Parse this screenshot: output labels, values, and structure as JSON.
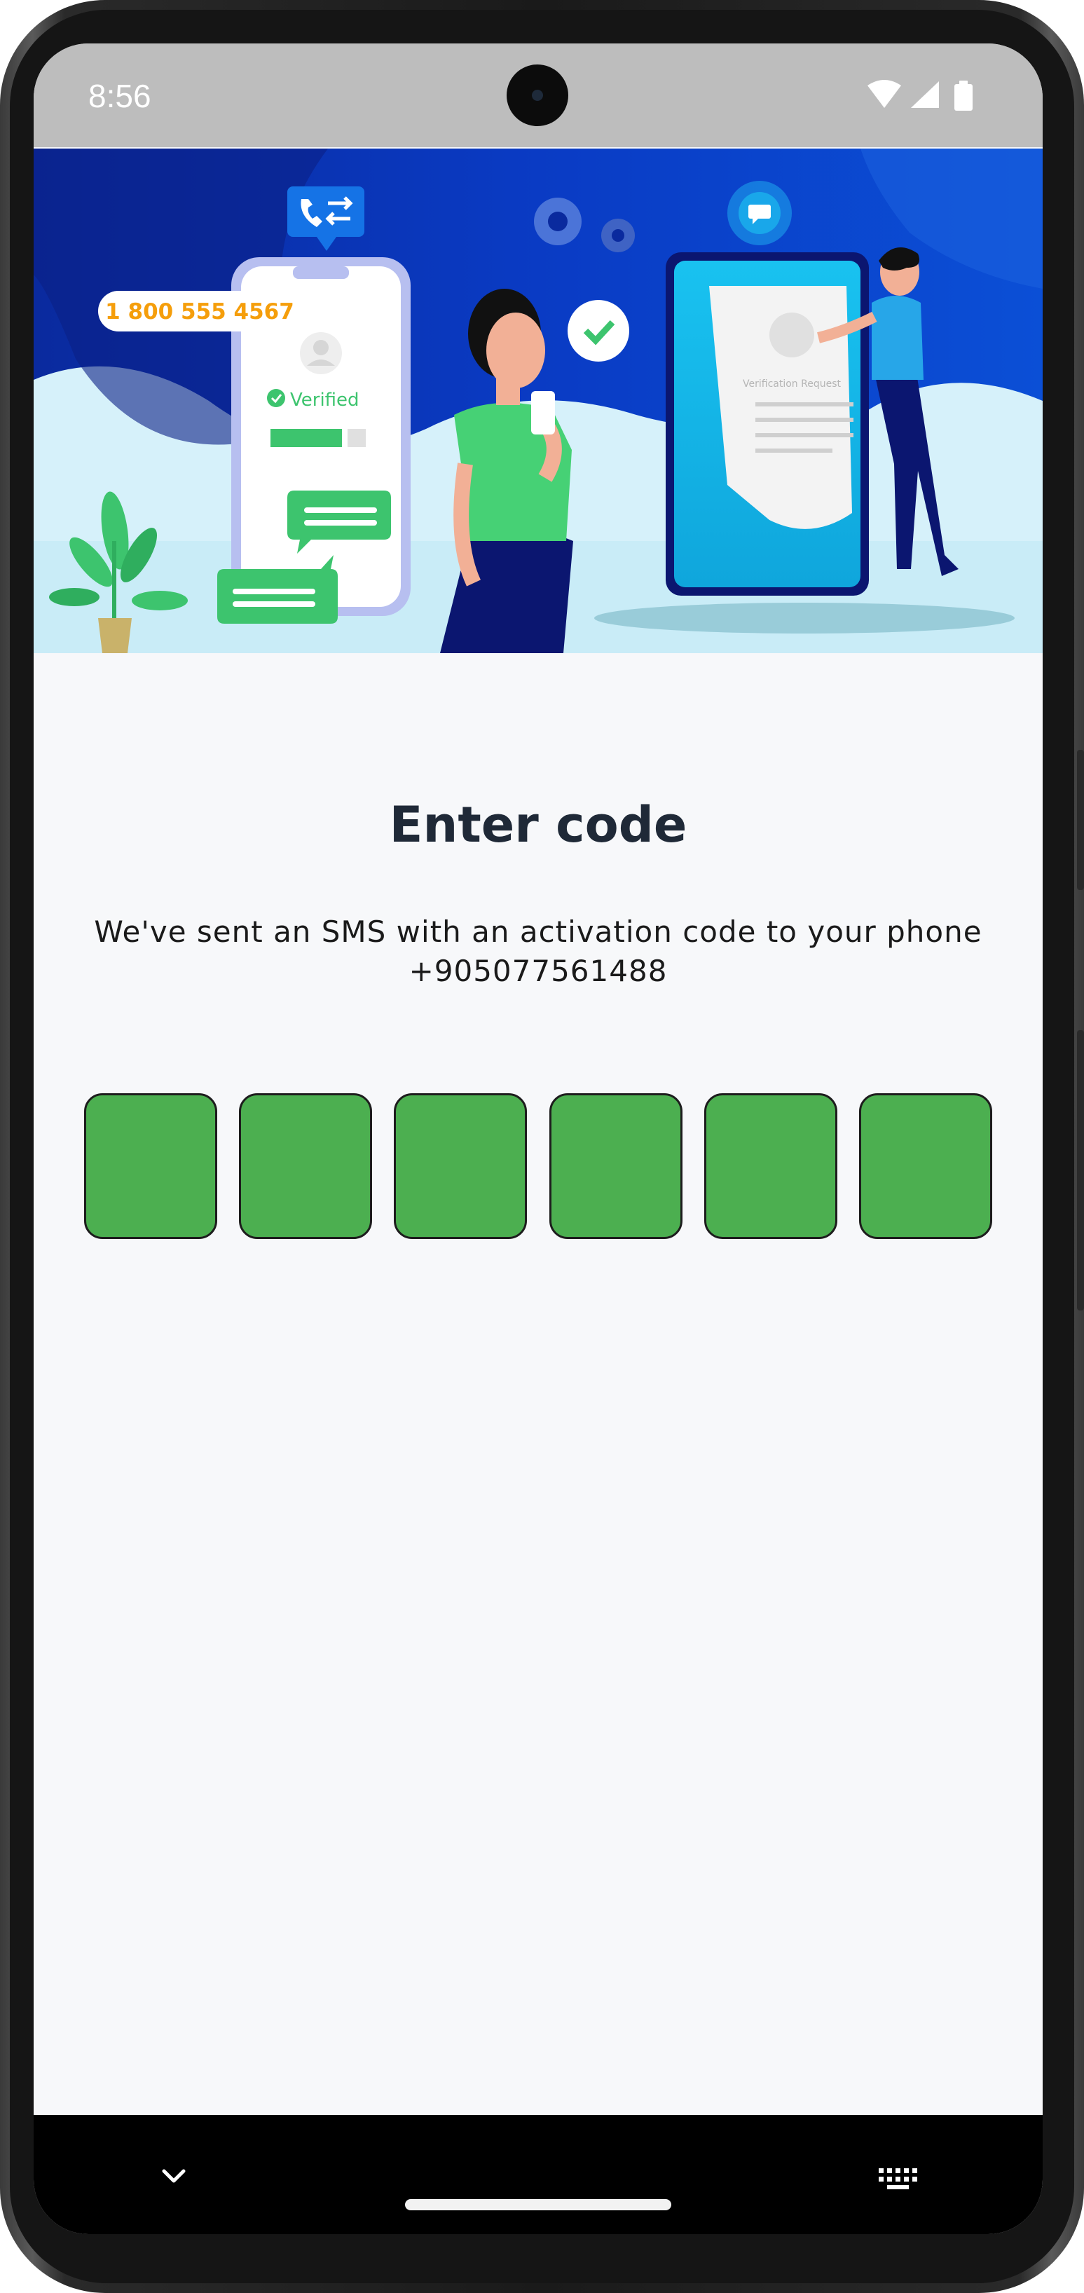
{
  "status_bar": {
    "time": "8:56",
    "icons": [
      "wifi-icon",
      "cellular-signal-icon",
      "battery-icon"
    ]
  },
  "hero": {
    "phone_number": "1 800 555 4567",
    "verified_label": "Verified",
    "document_label": "Verification Request",
    "icons": [
      "phone-call-transfer-icon",
      "gear-icon",
      "chat-icon",
      "checkmark-icon",
      "plant-illustration"
    ]
  },
  "main": {
    "title": "Enter code",
    "subtitle_line1": "We've sent an SMS with an activation code to your phone",
    "phone": "+905077561488",
    "code_digits": [
      "",
      "",
      "",
      "",
      "",
      ""
    ]
  },
  "nav_bar": {
    "icons": [
      "chevron-down-icon",
      "keyboard-icon"
    ]
  },
  "colors": {
    "status_bar_bg": "#bdbdbd",
    "page_bg": "#f7f8fa",
    "code_box_fill": "#4caf50",
    "title_color": "#1f2937",
    "nav_bg": "#000000",
    "accent_blue": "#0b3fd1",
    "accent_green": "#4cd27a",
    "accent_orange": "#f59e0b"
  }
}
